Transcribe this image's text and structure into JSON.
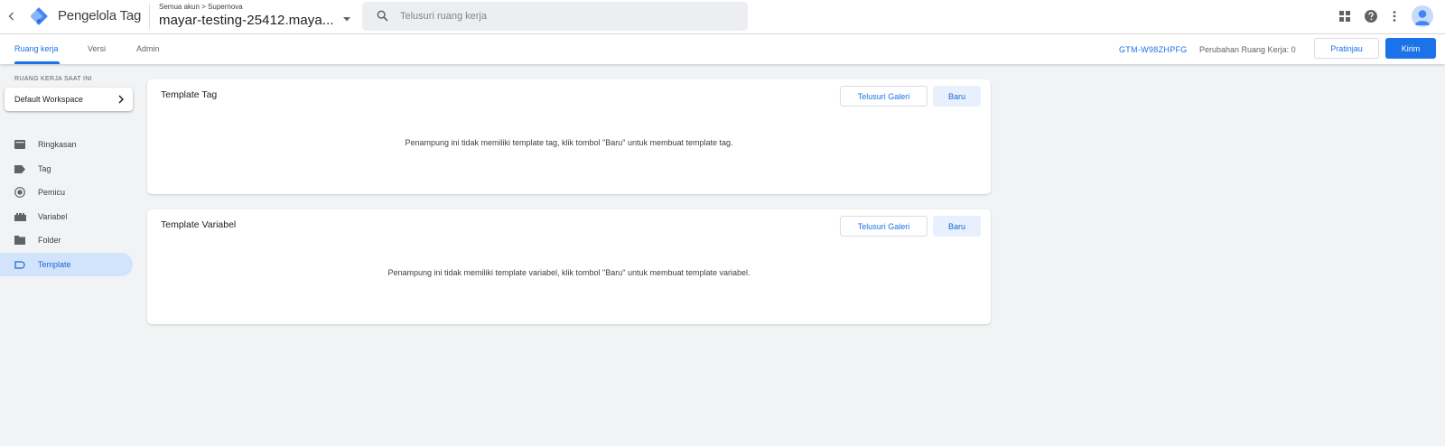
{
  "header": {
    "app_name": "Pengelola Tag",
    "breadcrumb": "Semua akun > Supernova",
    "container_name": "mayar-testing-25412.maya...",
    "search_placeholder": "Telusuri ruang kerja"
  },
  "icons": {
    "back": "arrow-back-icon",
    "logo": "gtm-logo",
    "search": "search-icon",
    "apps": "apps-grid-icon",
    "help": "help-icon",
    "more": "more-vert-icon",
    "avatar": "account-avatar"
  },
  "subnav": {
    "tabs": [
      {
        "label": "Ruang kerja",
        "active": true
      },
      {
        "label": "Versi",
        "active": false
      },
      {
        "label": "Admin",
        "active": false
      }
    ],
    "container_id": "GTM-W98ZHPFG",
    "changes_label": "Perubahan Ruang Kerja: 0",
    "preview_label": "Pratinjau",
    "submit_label": "Kirim"
  },
  "sidebar": {
    "current_ws_label": "RUANG KERJA SAAT INI",
    "workspace_name": "Default Workspace",
    "items": [
      {
        "label": "Ringkasan",
        "icon": "overview-icon",
        "active": false
      },
      {
        "label": "Tag",
        "icon": "tag-icon",
        "active": false
      },
      {
        "label": "Pemicu",
        "icon": "trigger-icon",
        "active": false
      },
      {
        "label": "Variabel",
        "icon": "variable-icon",
        "active": false
      },
      {
        "label": "Folder",
        "icon": "folder-icon",
        "active": false
      },
      {
        "label": "Template",
        "icon": "template-icon",
        "active": true
      }
    ]
  },
  "cards": [
    {
      "title": "Template Tag",
      "gallery_label": "Telusuri Galeri",
      "new_label": "Baru",
      "empty_text": "Penampung ini tidak memiliki template tag, klik tombol \"Baru\" untuk membuat template tag."
    },
    {
      "title": "Template Variabel",
      "gallery_label": "Telusuri Galeri",
      "new_label": "Baru",
      "empty_text": "Penampung ini tidak memiliki template variabel, klik tombol \"Baru\" untuk membuat template variabel."
    }
  ],
  "colors": {
    "accent": "#1a73e8",
    "logo_light": "#8ab4f8",
    "logo_dark": "#4285f4",
    "active_nav_bg": "#d2e3fc",
    "page_bg": "#f1f3f4"
  }
}
